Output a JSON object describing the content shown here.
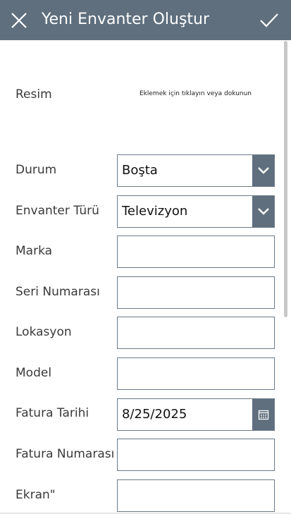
{
  "header": {
    "title": "Yeni Envanter Oluştur",
    "close_icon": "close-icon",
    "confirm_icon": "checkmark-icon",
    "background": "#5f6f7e"
  },
  "form": {
    "image": {
      "label": "Resim",
      "hint": "Eklemek için tıklayın veya dokunun"
    },
    "status": {
      "label": "Durum",
      "value": "Boşta",
      "icon": "chevron-down-icon"
    },
    "inventory_type": {
      "label": "Envanter Türü",
      "value": "Televizyon",
      "icon": "chevron-down-icon"
    },
    "brand": {
      "label": "Marka",
      "value": ""
    },
    "serial_number": {
      "label": "Seri Numarası",
      "value": ""
    },
    "location": {
      "label": "Lokasyon",
      "value": ""
    },
    "model": {
      "label": "Model",
      "value": ""
    },
    "invoice_date": {
      "label": "Fatura Tarihi",
      "value": "8/25/2025",
      "icon": "calendar-icon"
    },
    "invoice_number": {
      "label": "Fatura Numarası",
      "value": ""
    },
    "screen": {
      "label": "Ekran\"",
      "value": ""
    }
  }
}
